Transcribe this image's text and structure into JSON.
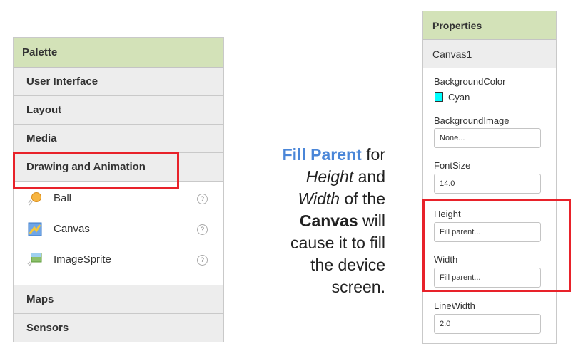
{
  "palette": {
    "title": "Palette",
    "categories_top": [
      "User Interface",
      "Layout",
      "Media",
      "Drawing and Animation"
    ],
    "items": [
      {
        "label": "Ball",
        "icon": "ball-icon"
      },
      {
        "label": "Canvas",
        "icon": "canvas-icon"
      },
      {
        "label": "ImageSprite",
        "icon": "imagesprite-icon"
      }
    ],
    "help_glyph": "?",
    "categories_bottom": [
      "Maps",
      "Sensors"
    ]
  },
  "note": {
    "fill_parent": "Fill Parent",
    "for": " for",
    "height": "Height",
    "and": " and",
    "width": "Width",
    "of_the": " of the",
    "canvas": "Canvas",
    "will": " will",
    "line5": "cause it to fill",
    "line6": "the device",
    "line7": "screen."
  },
  "properties": {
    "title": "Properties",
    "component": "Canvas1",
    "background_color_label": "BackgroundColor",
    "background_color_value": "Cyan",
    "background_color_hex": "#00ffff",
    "background_image_label": "BackgroundImage",
    "background_image_value": "None...",
    "font_size_label": "FontSize",
    "font_size_value": "14.0",
    "height_label": "Height",
    "height_value": "Fill parent...",
    "width_label": "Width",
    "width_value": "Fill parent...",
    "line_width_label": "LineWidth",
    "line_width_value": "2.0"
  },
  "colors": {
    "header_green": "#d3e2b8",
    "highlight_red": "#e8222a",
    "accent_blue": "#4a86d8"
  }
}
